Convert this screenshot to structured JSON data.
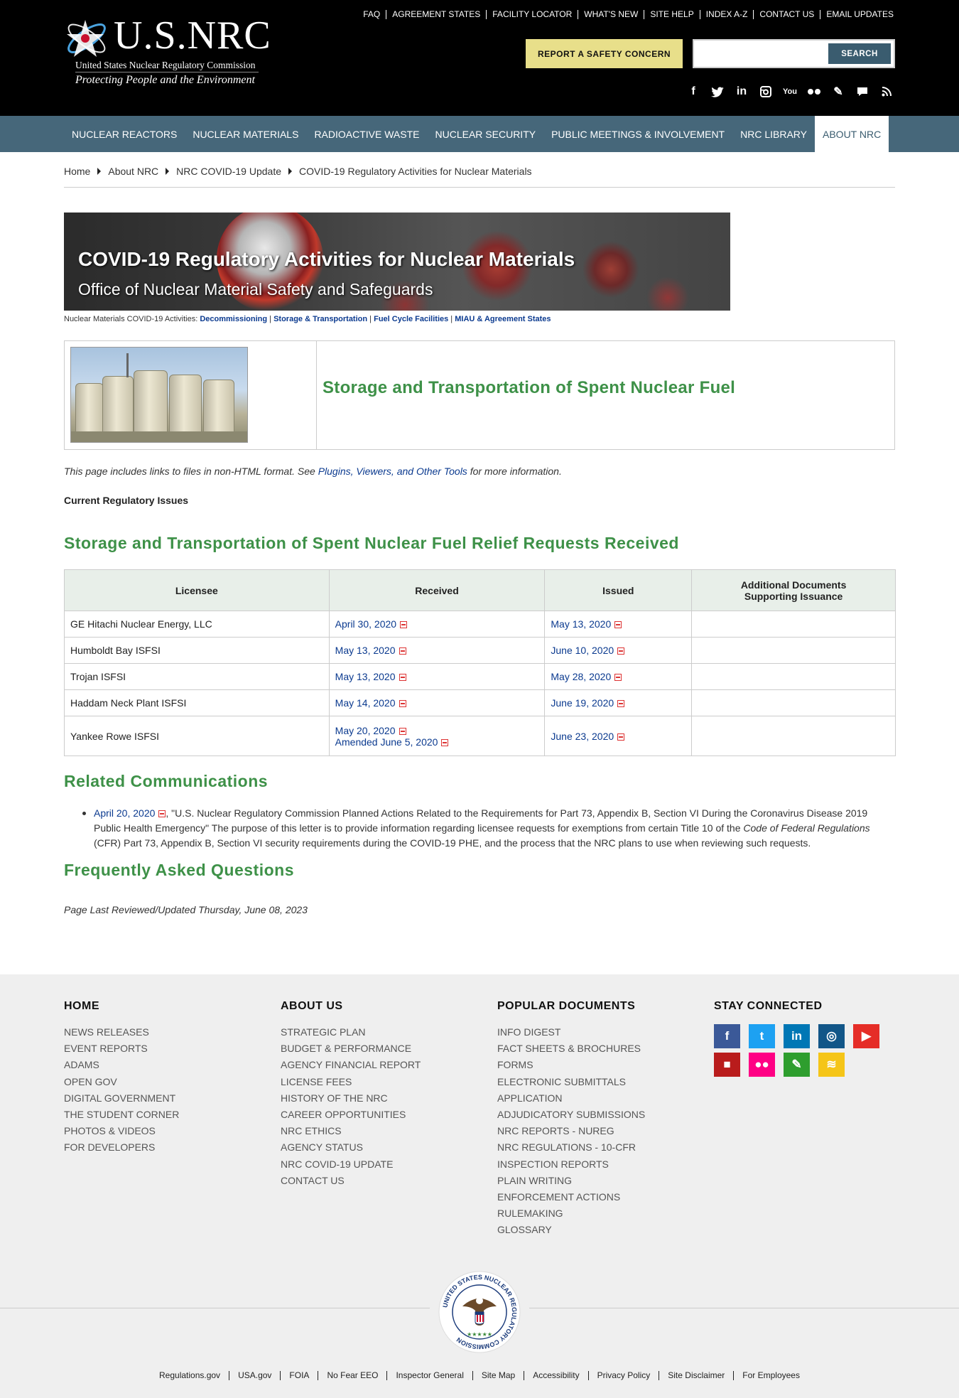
{
  "header": {
    "logo_name": "U.S.NRC",
    "logo_sub": "United States Nuclear Regulatory Commission",
    "logo_tagline": "Protecting People and the Environment",
    "top_links": [
      "FAQ",
      "AGREEMENT STATES",
      "FACILITY LOCATOR",
      "WHAT'S NEW",
      "SITE HELP",
      "INDEX A-Z",
      "CONTACT US",
      "EMAIL UPDATES"
    ],
    "report_button": "REPORT A SAFETY CONCERN",
    "search_value": "",
    "search_placeholder": "",
    "search_button": "SEARCH",
    "social_icons": [
      "facebook-icon",
      "twitter-icon",
      "linkedin-icon",
      "instagram-icon",
      "youtube-icon",
      "flickr-icon",
      "blog-pen-icon",
      "comment-icon",
      "rss-icon"
    ]
  },
  "nav": {
    "items": [
      "NUCLEAR REACTORS",
      "NUCLEAR MATERIALS",
      "RADIOACTIVE WASTE",
      "NUCLEAR SECURITY",
      "PUBLIC MEETINGS & INVOLVEMENT",
      "NRC LIBRARY",
      "ABOUT NRC"
    ],
    "active": "ABOUT NRC"
  },
  "breadcrumb": [
    "Home",
    "About NRC",
    "NRC COVID-19 Update",
    "COVID-19 Regulatory Activities for Nuclear Materials"
  ],
  "banner": {
    "title": "COVID-19 Regulatory Activities for Nuclear Materials",
    "subtitle": "Office of Nuclear Material Safety and Safeguards"
  },
  "activities": {
    "label": "Nuclear Materials COVID-19 Activities:",
    "links": [
      "Decommissioning",
      "Storage & Transportation",
      "Fuel Cycle Facilities",
      "MIAU & Agreement States"
    ]
  },
  "feature": {
    "title": "Storage and Transportation of Spent Nuclear Fuel"
  },
  "note": {
    "prefix": "This page includes links to files in non-HTML format. See ",
    "link": "Plugins, Viewers, and Other Tools",
    "suffix": " for more information."
  },
  "current_issues": "Current Regulatory Issues",
  "relief": {
    "heading": "Storage and Transportation of Spent Nuclear Fuel Relief Requests Received",
    "columns": [
      "Licensee",
      "Received",
      "Issued",
      "Additional Documents",
      "Supporting Issuance"
    ],
    "rows": [
      {
        "licensee": "GE Hitachi Nuclear Energy, LLC",
        "received": [
          "April 30, 2020"
        ],
        "issued": "May 13, 2020",
        "additional": ""
      },
      {
        "licensee": "Humboldt Bay ISFSI",
        "received": [
          "May 13, 2020"
        ],
        "issued": "June 10, 2020",
        "additional": ""
      },
      {
        "licensee": "Trojan ISFSI",
        "received": [
          "May 13, 2020"
        ],
        "issued": "May 28, 2020",
        "additional": ""
      },
      {
        "licensee": "Haddam Neck Plant ISFSI",
        "received": [
          "May 14, 2020"
        ],
        "issued": "June 19, 2020",
        "additional": ""
      },
      {
        "licensee": "Yankee Rowe ISFSI",
        "received": [
          "May 20, 2020",
          "Amended June 5, 2020"
        ],
        "issued": "June 23, 2020",
        "additional": ""
      }
    ]
  },
  "related": {
    "heading": "Related Communications",
    "item_link": "April 20, 2020",
    "item_text_1": ", \"U.S. Nuclear Regulatory Commission Planned Actions Related to the Requirements for Part 73, Appendix B, Section VI During the Coronavirus Disease 2019 Public Health Emergency\"   The purpose of this letter is to provide information regarding licensee requests for exemptions from certain Title 10 of the ",
    "item_italic": "Code of Federal Regulations",
    "item_text_2": " (CFR) Part 73, Appendix B, Section VI security requirements during the COVID-19 PHE, and the process that the NRC plans to use when reviewing such requests."
  },
  "faq_heading": "Frequently Asked Questions",
  "updated": "Page Last Reviewed/Updated Thursday, June 08, 2023",
  "footer": {
    "home": {
      "heading": "HOME",
      "links": [
        "NEWS RELEASES",
        "EVENT REPORTS",
        "ADAMS",
        "OPEN GOV",
        "DIGITAL GOVERNMENT",
        "THE STUDENT CORNER",
        "PHOTOS & VIDEOS",
        "FOR DEVELOPERS"
      ]
    },
    "about": {
      "heading": "ABOUT US",
      "links": [
        "STRATEGIC PLAN",
        "BUDGET & PERFORMANCE",
        "AGENCY FINANCIAL REPORT",
        "LICENSE FEES",
        "HISTORY OF THE NRC",
        "CAREER OPPORTUNITIES",
        "NRC ETHICS",
        "AGENCY STATUS",
        "NRC COVID-19 UPDATE",
        "CONTACT US"
      ]
    },
    "popular": {
      "heading": "POPULAR DOCUMENTS",
      "links": [
        "INFO DIGEST",
        "FACT SHEETS & BROCHURES",
        "FORMS",
        "ELECTRONIC SUBMITTALS",
        "APPLICATION",
        "ADJUDICATORY SUBMISSIONS",
        "NRC REPORTS - NUREG",
        "NRC REGULATIONS - 10-CFR",
        "INSPECTION REPORTS",
        "PLAIN WRITING",
        "ENFORCEMENT ACTIONS",
        "RULEMAKING",
        "GLOSSARY"
      ]
    },
    "connect": {
      "heading": "STAY CONNECTED",
      "icons": [
        {
          "name": "facebook-icon",
          "color": "#3b5998",
          "glyph": "f"
        },
        {
          "name": "twitter-icon",
          "color": "#1da1f2",
          "glyph": "t"
        },
        {
          "name": "linkedin-icon",
          "color": "#0077b5",
          "glyph": "in"
        },
        {
          "name": "instagram-icon",
          "color": "#125688",
          "glyph": "◎"
        },
        {
          "name": "youtube-icon",
          "color": "#e52d27",
          "glyph": "▶"
        },
        {
          "name": "comment-icon",
          "color": "#b91c1c",
          "glyph": "■"
        },
        {
          "name": "flickr-icon",
          "color": "#ff0084",
          "glyph": "●●"
        },
        {
          "name": "blog-pen-icon",
          "color": "#2e9e2e",
          "glyph": "✎"
        },
        {
          "name": "rss-icon",
          "color": "#f5c518",
          "glyph": "≋"
        }
      ]
    },
    "seal_text": "UNITED STATES NUCLEAR REGULATORY COMMISSION",
    "bottom_links": [
      "Regulations.gov",
      "USA.gov",
      "FOIA",
      "No Fear EEO",
      "Inspector General",
      "Site Map",
      "Accessibility",
      "Privacy Policy",
      "Site Disclaimer",
      "For Employees"
    ]
  }
}
